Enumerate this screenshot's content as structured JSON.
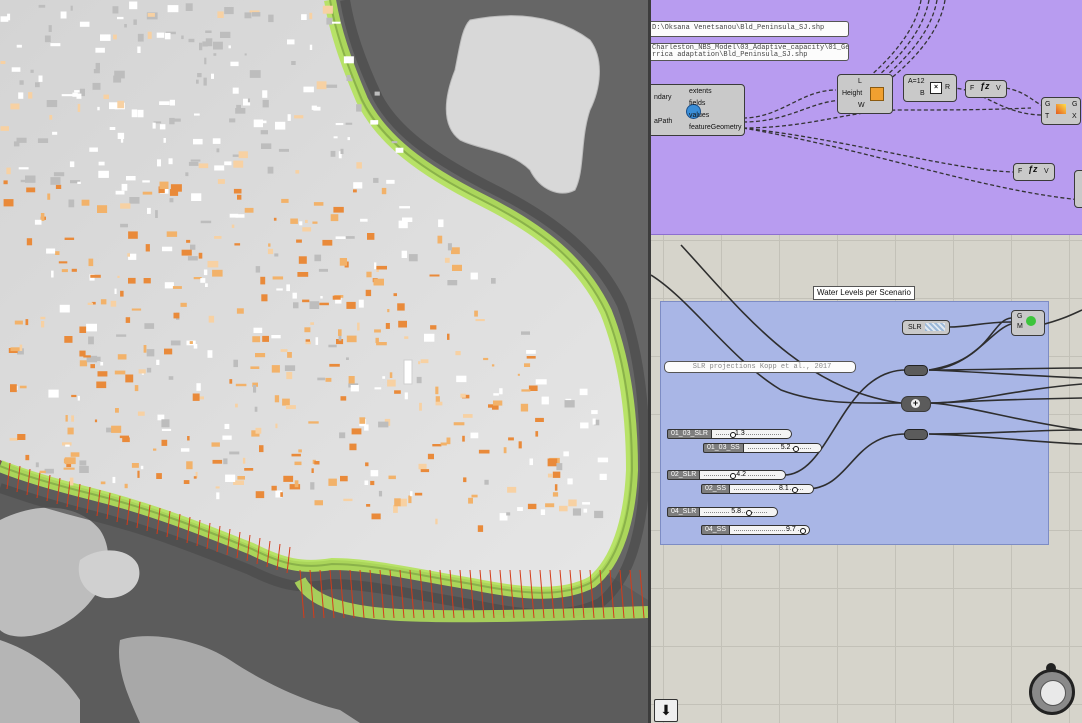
{
  "panels": {
    "file_path_1": "D:\\Oksana Venetsanou\\Bld_Peninsula_SJ.shp",
    "file_path_2": "Charleston_NBS_Model\\03_Adaptive_capacity\\01_Ge",
    "file_path_2b": "rrica adaptation\\Bld_Peninsula_SJ.shp",
    "slr_source": "SLR projections Kopp et al., 2017"
  },
  "shapefile_component": {
    "inputs": [
      "ndary",
      "aPath"
    ],
    "outputs": [
      "extents",
      "fields",
      "values",
      "featureGeometry"
    ]
  },
  "box_component": {
    "inputs": [
      "L",
      "Height",
      "W"
    ],
    "output": "B"
  },
  "multiply_component": {
    "inputs": [
      "A=12",
      "B"
    ],
    "output": "R",
    "icon": "multiply-icon"
  },
  "function_components": [
    {
      "inputs": "F",
      "output": "V"
    },
    {
      "inputs": "F",
      "output": "V"
    }
  ],
  "gradient_component": {
    "inputs": [
      "G",
      "T"
    ],
    "outputs": [
      "G",
      "X"
    ]
  },
  "group": {
    "title": "Water Levels per Scenario"
  },
  "slr_param": {
    "label": "SLR"
  },
  "gradient_out": {
    "inputs": [
      "G",
      "M"
    ]
  },
  "sliders": [
    {
      "name": "01_03_SLR",
      "value": "1.3"
    },
    {
      "name": "01_03_SS",
      "value": "5.2"
    },
    {
      "name": "02_SLR",
      "value": "4.2"
    },
    {
      "name": "02_SS",
      "value": "8.1"
    },
    {
      "name": "04_SLR",
      "value": "5.8"
    },
    {
      "name": "04_SS",
      "value": "9.7"
    }
  ],
  "colors": {
    "purple_group": "#b89cf0",
    "blue_group": "#a9b6e6",
    "canvas_bg": "#d6d4cb",
    "building_warm": "#f0a24a",
    "levee_green": "#b3e25a"
  }
}
